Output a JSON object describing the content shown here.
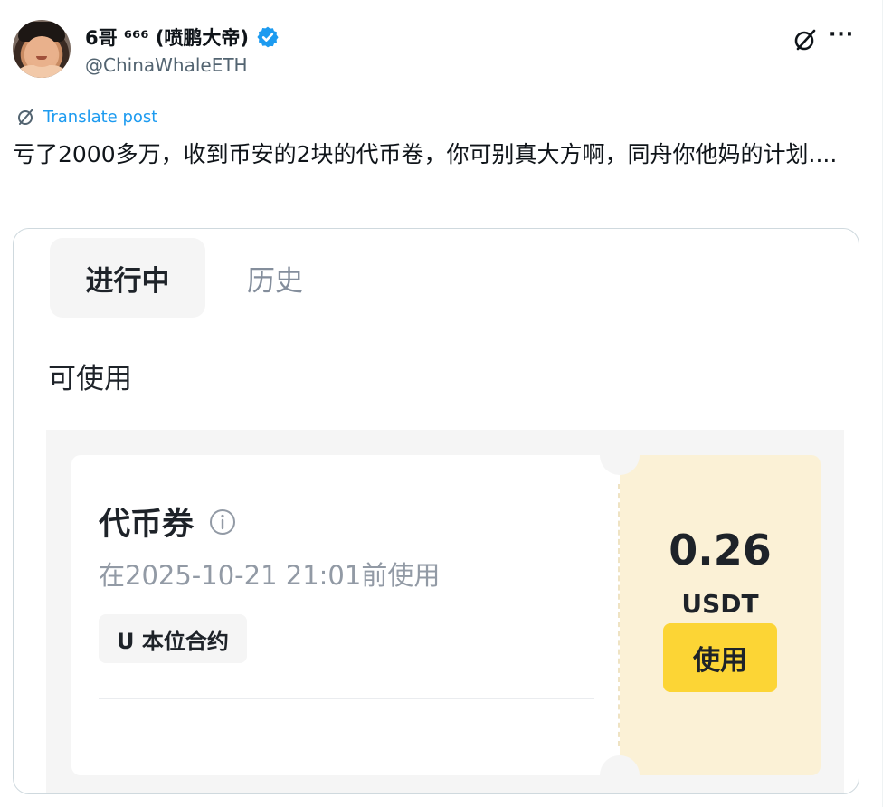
{
  "post": {
    "author": {
      "display_name": "6哥 ⁶⁶⁶ (喷鹏大帝)",
      "handle": "@ChinaWhaleETH",
      "verified": true
    },
    "translate_label": "Translate post",
    "text": "亏了2000多万，收到币安的2块的代币卷，你可别真大方啊，同舟你他妈的计划....",
    "icons": [
      "grok-icon",
      "more-icon",
      "verified-badge-icon",
      "translate-icon"
    ],
    "more_glyph": "···"
  },
  "screenshot": {
    "tabs": [
      {
        "label": "进行中",
        "active": true
      },
      {
        "label": "历史",
        "active": false
      }
    ],
    "section_label": "可使用",
    "coupon": {
      "title": "代币券",
      "expiry": "在2025-10-21 21:01前使用",
      "tag": "U 本位合约",
      "amount": "0.26",
      "unit": "USDT",
      "use_button": "使用"
    }
  },
  "colors": {
    "link_blue": "#1d9bf0",
    "verified_blue": "#1d9bf0",
    "button_yellow": "#fcd535",
    "coupon_right_bg": "#fbf1d6",
    "text_primary": "#0f1419",
    "text_secondary": "#536471"
  }
}
